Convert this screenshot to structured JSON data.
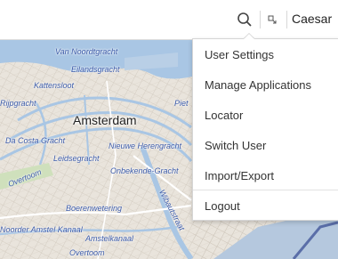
{
  "header": {
    "user_name": "Caesar",
    "search_icon": "search-icon",
    "expand_icon": "expand-icon"
  },
  "map": {
    "city_label": "Amsterdam",
    "street_labels": [
      "Van Noordtgracht",
      "Eilandsgracht",
      "Kattensloot",
      "Rijpgracht",
      "Piet",
      "Da Costa Gracht",
      "Nieuwe Herengracht",
      "Leidsegracht",
      "Onbekende-Gracht",
      "Overtoom",
      "Boerenwetering",
      "Wibautstraat",
      "Noorder Amstel Kanaal",
      "Amstelkanaal",
      "Overtoom"
    ]
  },
  "user_menu": {
    "items": [
      "User Settings",
      "Manage Applications",
      "Locator",
      "Switch User",
      "Import/Export",
      "Logout"
    ]
  },
  "colors": {
    "water": "#a9c6e4",
    "land": "#e9e4dc",
    "street_label": "#3b5aa8"
  }
}
